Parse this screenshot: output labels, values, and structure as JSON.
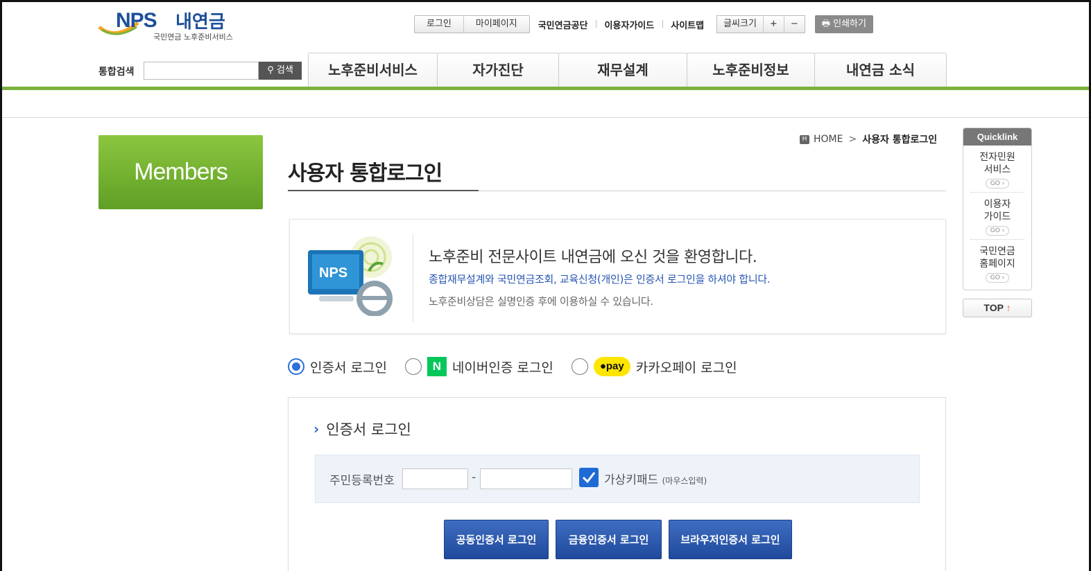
{
  "logo": {
    "brand": "NPS",
    "brand_ko": "내연금",
    "sub": "국민연금 노후준비서비스"
  },
  "util": {
    "login": "로그인",
    "mypage": "마이페이지",
    "links": [
      "국민연금공단",
      "이용자가이드",
      "사이트맵"
    ],
    "font_size": "글씨크기",
    "font_plus": "+",
    "font_minus": "−",
    "print": "인쇄하기"
  },
  "search": {
    "label": "통합검색",
    "button": "검색"
  },
  "gnb": [
    "노후준비서비스",
    "자가진단",
    "재무설계",
    "노후준비정보",
    "내연금 소식"
  ],
  "left": {
    "section_title": "Members"
  },
  "breadcrumb": {
    "home": "HOME",
    "current": "사용자 통합로그인"
  },
  "page_title": "사용자 통합로그인",
  "welcome": {
    "illustration_text": "NPS",
    "line1": "노후준비 전문사이트 내연금에 오신 것을 환영합니다.",
    "line2": "종합재무설계와 국민연금조회, 교육신청(개인)은 인증서 로그인을 하셔야 합니다.",
    "line3": "노후준비상담은 실명인증 후에 이용하실 수 있습니다."
  },
  "login_methods": {
    "cert": "인증서 로그인",
    "naver_logo": "N",
    "naver": "네이버인증 로그인",
    "kakao_logo": "pay",
    "kakao": "카카오페이 로그인",
    "selected": "cert"
  },
  "cert_panel": {
    "title": "인증서 로그인",
    "rrn_label": "주민등록번호",
    "dash": "-",
    "virtual_keypad": "가상키패드",
    "virtual_keypad_note": "(마우스입력)",
    "virtual_keypad_checked": true,
    "buttons": [
      "공동인증서 로그인",
      "금융인증서 로그인",
      "브라우저인증서 로그인"
    ]
  },
  "quicklink": {
    "title": "Quicklink",
    "items": [
      {
        "line1": "전자민원",
        "line2": "서비스",
        "go": "GO"
      },
      {
        "line1": "이용자",
        "line2": "가이드",
        "go": "GO"
      },
      {
        "line1": "국민연금",
        "line2": "홈페이지",
        "go": "GO"
      }
    ],
    "top": "TOP",
    "top_arrow": "↑"
  },
  "colors": {
    "brand_green": "#7ab23c",
    "brand_blue": "#1d4f9c",
    "button_blue": "#1f4a9c"
  }
}
